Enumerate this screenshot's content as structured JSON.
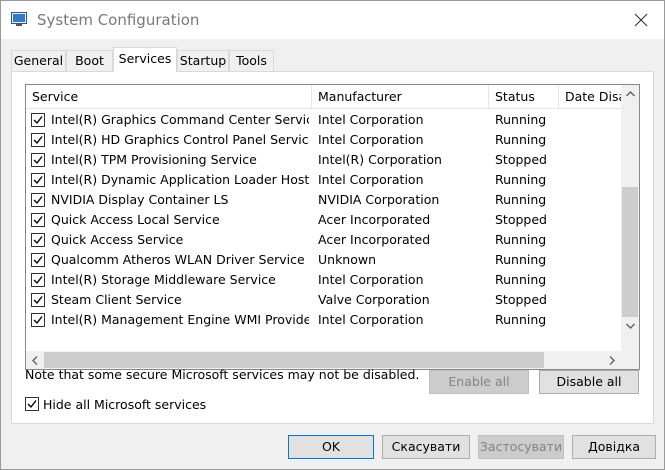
{
  "window": {
    "title": "System Configuration"
  },
  "tabs": [
    {
      "label": "General"
    },
    {
      "label": "Boot"
    },
    {
      "label": "Services"
    },
    {
      "label": "Startup"
    },
    {
      "label": "Tools"
    }
  ],
  "columns": {
    "service": "Service",
    "manufacturer": "Manufacturer",
    "status": "Status",
    "date_disabled": "Date Disa"
  },
  "services": [
    {
      "name": "Intel(R) Graphics Command Center Service",
      "manufacturer": "Intel Corporation",
      "status": "Running"
    },
    {
      "name": "Intel(R) HD Graphics Control Panel Service",
      "manufacturer": "Intel Corporation",
      "status": "Running"
    },
    {
      "name": "Intel(R) TPM Provisioning Service",
      "manufacturer": "Intel(R) Corporation",
      "status": "Stopped"
    },
    {
      "name": "Intel(R) Dynamic Application Loader Host I...",
      "manufacturer": "Intel Corporation",
      "status": "Running"
    },
    {
      "name": "NVIDIA Display Container LS",
      "manufacturer": "NVIDIA Corporation",
      "status": "Running"
    },
    {
      "name": "Quick Access Local Service",
      "manufacturer": "Acer Incorporated",
      "status": "Stopped"
    },
    {
      "name": "Quick Access Service",
      "manufacturer": "Acer Incorporated",
      "status": "Running"
    },
    {
      "name": "Qualcomm Atheros WLAN Driver Service",
      "manufacturer": "Unknown",
      "status": "Running"
    },
    {
      "name": "Intel(R) Storage Middleware Service",
      "manufacturer": "Intel Corporation",
      "status": "Running"
    },
    {
      "name": "Steam Client Service",
      "manufacturer": "Valve Corporation",
      "status": "Stopped"
    },
    {
      "name": "Intel(R) Management Engine WMI Provider...",
      "manufacturer": "Intel Corporation",
      "status": "Running"
    }
  ],
  "note": "Note that some secure Microsoft services may not be disabled.",
  "buttons": {
    "enable_all": "Enable all",
    "disable_all": "Disable all",
    "ok": "OK",
    "cancel": "Скасувати",
    "apply": "Застосувати",
    "help": "Довідка"
  },
  "hide_ms": {
    "label": "Hide all Microsoft services",
    "checked": true
  },
  "icons": {
    "app": "system-config-icon",
    "close": "close-icon",
    "check": "checkmark-icon"
  },
  "colors": {
    "accent": "#0078d7"
  }
}
